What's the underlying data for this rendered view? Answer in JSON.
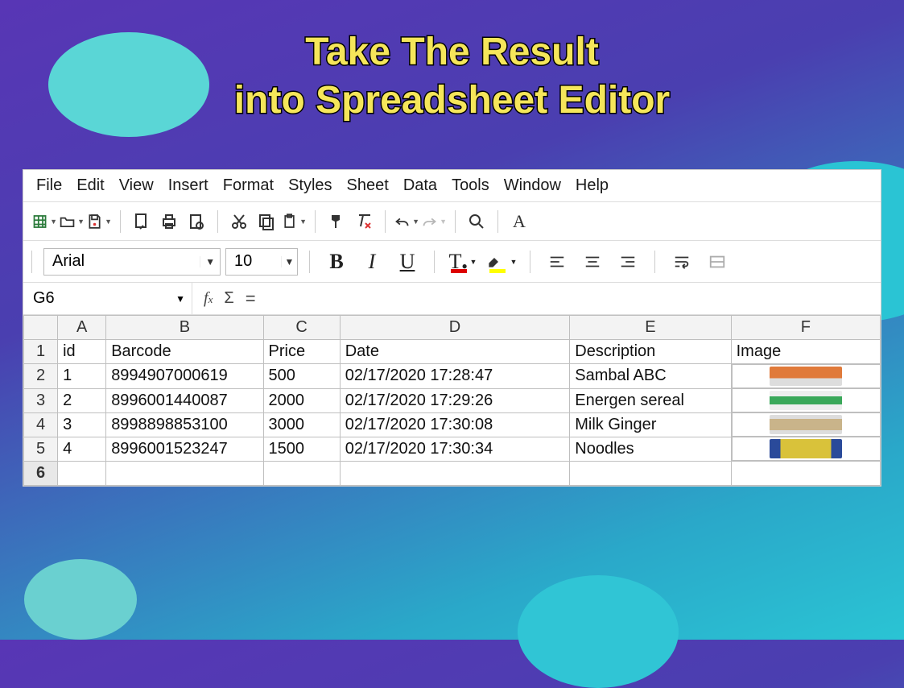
{
  "title_line1": "Take The Result",
  "title_line2": "into Spreadsheet Editor",
  "menu": [
    "File",
    "Edit",
    "View",
    "Insert",
    "Format",
    "Styles",
    "Sheet",
    "Data",
    "Tools",
    "Window",
    "Help"
  ],
  "font": {
    "name": "Arial",
    "size": "10"
  },
  "cellref": "G6",
  "formula": "",
  "columns": [
    "A",
    "B",
    "C",
    "D",
    "E",
    "F"
  ],
  "chart_data": {
    "type": "table",
    "headers": [
      "id",
      "Barcode",
      "Price",
      "Date",
      "Description",
      "Image"
    ],
    "rows": [
      {
        "id": "1",
        "barcode": "8994907000619",
        "price": "500",
        "date": "02/17/2020 17:28:47",
        "desc": "Sambal ABC",
        "img": "#e07a3a"
      },
      {
        "id": "2",
        "barcode": "8996001440087",
        "price": "2000",
        "date": "02/17/2020 17:29:26",
        "desc": "Energen sereal",
        "img": "#3aa85a"
      },
      {
        "id": "3",
        "barcode": "8998898853100",
        "price": "3000",
        "date": "02/17/2020 17:30:08",
        "desc": "Milk Ginger",
        "img": "#c9b48a"
      },
      {
        "id": "4",
        "barcode": "8996001523247",
        "price": "1500",
        "date": "02/17/2020 17:30:34",
        "desc": "Noodles",
        "img": "#d9c23a"
      }
    ]
  },
  "selected_row": "6"
}
